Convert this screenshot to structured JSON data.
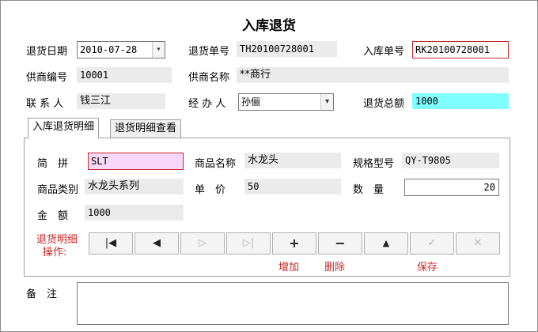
{
  "title": "入库退货",
  "header": {
    "return_date_label": "退货日期",
    "return_date_value": "2010-07-28",
    "return_no_label": "退货单号",
    "return_no_value": "TH20100728001",
    "in_no_label": "入库单号",
    "in_no_value": "RK20100728001",
    "supplier_code_label": "供商编号",
    "supplier_code_value": "10001",
    "supplier_name_label": "供商名称",
    "supplier_name_value": "**商行",
    "contact_label": "联 系 人",
    "contact_value": "钱三江",
    "handler_label": "经 办 人",
    "handler_value": "孙俪",
    "total_label": "退货总额",
    "total_value": "1000"
  },
  "tabs": [
    {
      "label": "入库退货明细"
    },
    {
      "label": "退货明细查看"
    }
  ],
  "detail": {
    "pinyin_label": "简　拼",
    "pinyin_value": "SLT",
    "name_label": "商品名称",
    "name_value": "水龙头",
    "spec_label": "规格型号",
    "spec_value": "QY-T9805",
    "category_label": "商品类别",
    "category_value": "水龙头系列",
    "price_label": "单　价",
    "price_value": "50",
    "qty_label": "数　量",
    "qty_value": "20",
    "amount_label": "金　额",
    "amount_value": "1000"
  },
  "ops": {
    "label_line1": "退货明细",
    "label_line2": "操作:",
    "add_label": "增加",
    "delete_label": "删除",
    "save_label": "保存",
    "buttons": [
      {
        "icon": "first-record-icon",
        "glyph": "|◀"
      },
      {
        "icon": "prev-record-icon",
        "glyph": "◀"
      },
      {
        "icon": "next-record-icon",
        "glyph": "▷"
      },
      {
        "icon": "last-record-icon",
        "glyph": "▷|"
      },
      {
        "icon": "plus-icon",
        "glyph": "+"
      },
      {
        "icon": "minus-icon",
        "glyph": "−"
      },
      {
        "icon": "up-arrow-icon",
        "glyph": "▲"
      },
      {
        "icon": "checkmark-icon",
        "glyph": "✓"
      },
      {
        "icon": "cancel-x-icon",
        "glyph": "✕"
      }
    ]
  },
  "remarks": {
    "label": "备　注",
    "value": ""
  },
  "colors": {
    "accent_red": "#c62828",
    "total_bg": "#80ffff",
    "pinyin_bg": "#f8d8f8"
  }
}
